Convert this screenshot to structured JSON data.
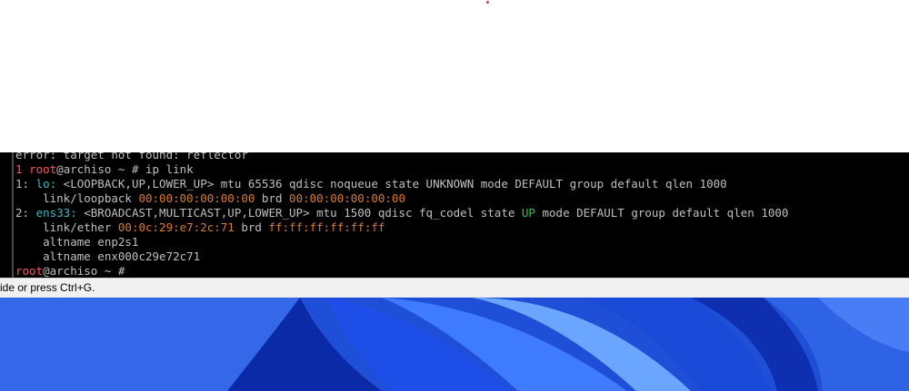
{
  "terminal": {
    "lines": [
      [
        {
          "t": "error: target not found: reflector",
          "c": ""
        }
      ],
      [
        {
          "t": "1 ",
          "c": "red"
        },
        {
          "t": "root",
          "c": "red"
        },
        {
          "t": "@archiso ~ # ip link",
          "c": ""
        }
      ],
      [
        {
          "t": "1: ",
          "c": ""
        },
        {
          "t": "lo:",
          "c": "cyan"
        },
        {
          "t": " <LOOPBACK,UP,LOWER_UP> mtu 65536 qdisc noqueue state UNKNOWN mode DEFAULT group default qlen 1000",
          "c": ""
        }
      ],
      [
        {
          "t": "    link/loopback ",
          "c": ""
        },
        {
          "t": "00:00:00:00:00:00",
          "c": "orange"
        },
        {
          "t": " brd ",
          "c": ""
        },
        {
          "t": "00:00:00:00:00:00",
          "c": "orange"
        }
      ],
      [
        {
          "t": "2: ",
          "c": ""
        },
        {
          "t": "ens33:",
          "c": "cyan"
        },
        {
          "t": " <BROADCAST,MULTICAST,UP,LOWER_UP> mtu 1500 qdisc fq_codel state ",
          "c": ""
        },
        {
          "t": "UP",
          "c": "green"
        },
        {
          "t": " mode DEFAULT group default qlen 1000",
          "c": ""
        }
      ],
      [
        {
          "t": "    link/ether ",
          "c": ""
        },
        {
          "t": "00:0c:29:e7:2c:71",
          "c": "orange"
        },
        {
          "t": " brd ",
          "c": ""
        },
        {
          "t": "ff:ff:ff:ff:ff:ff",
          "c": "orange"
        }
      ],
      [
        {
          "t": "    altname enp2s1",
          "c": ""
        }
      ],
      [
        {
          "t": "    altname enx000c29e72c71",
          "c": ""
        }
      ],
      [
        {
          "t": "root",
          "c": "red"
        },
        {
          "t": "@archiso ~ #",
          "c": ""
        }
      ]
    ]
  },
  "status_bar": {
    "text": "ide or press Ctrl+G."
  },
  "colors": {
    "terminal_bg": "#000000",
    "prompt_red": "#ff5555",
    "iface_cyan": "#3fb6c6",
    "mac_orange": "#d97a2c",
    "state_green": "#2ecc2e",
    "desktop_blue": "#2a5ce0"
  }
}
